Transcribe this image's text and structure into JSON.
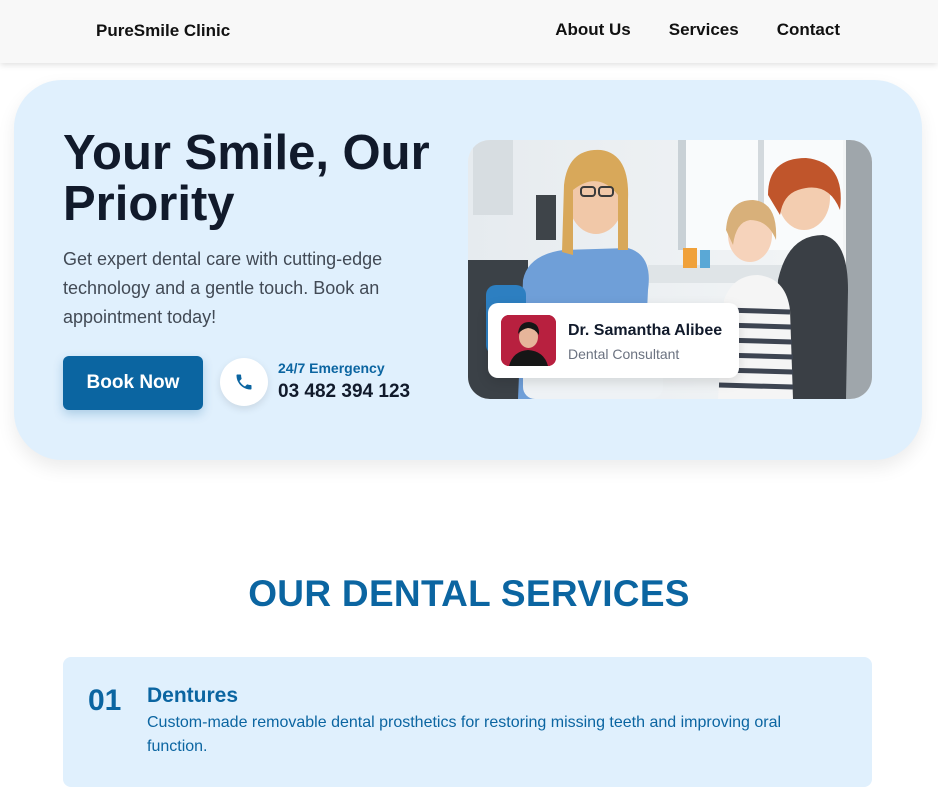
{
  "nav": {
    "brand": "PureSmile Clinic",
    "links": [
      "About Us",
      "Services",
      "Contact"
    ]
  },
  "hero": {
    "title": "Your Smile, Our Priority",
    "description": "Get expert dental care with cutting-edge technology and a gentle touch. Book an appointment today!",
    "book_label": "Book Now",
    "emergency_label": "24/7 Emergency",
    "emergency_number": "03 482 394 123",
    "phone_icon": "phone-icon"
  },
  "doctor": {
    "name": "Dr. Samantha Alibee",
    "role": "Dental Consultant"
  },
  "services": {
    "title": "OUR DENTAL SERVICES",
    "items": [
      {
        "number": "01",
        "name": "Dentures",
        "description": "Custom-made removable dental prosthetics for restoring missing teeth and improving oral function."
      }
    ]
  },
  "colors": {
    "accent": "#0b65a1",
    "hero_bg": "#e0f0fd",
    "heading": "#111a2b"
  }
}
